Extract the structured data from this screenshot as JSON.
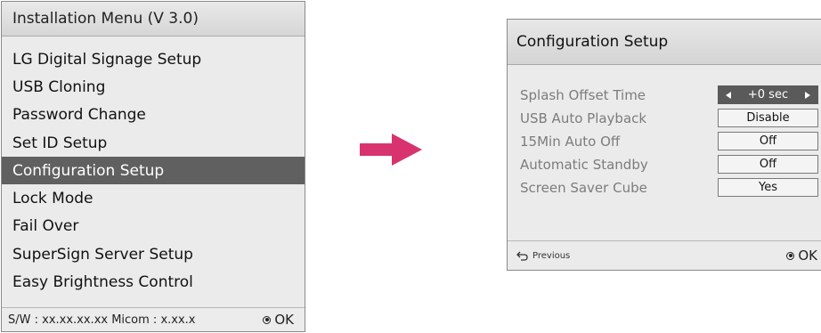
{
  "installation_menu": {
    "title": "Installation Menu (V 3.0)",
    "items": [
      {
        "label": "LG Digital Signage Setup",
        "selected": false
      },
      {
        "label": "USB Cloning",
        "selected": false
      },
      {
        "label": "Password Change",
        "selected": false
      },
      {
        "label": "Set ID Setup",
        "selected": false
      },
      {
        "label": "Configuration Setup",
        "selected": true
      },
      {
        "label": "Lock Mode",
        "selected": false
      },
      {
        "label": "Fail Over",
        "selected": false
      },
      {
        "label": "SuperSign Server Setup",
        "selected": false
      },
      {
        "label": "Easy Brightness Control",
        "selected": false
      }
    ],
    "footer": {
      "version_info": "S/W : xx.xx.xx.xx Micom : x.xx.x",
      "ok_label": "OK",
      "ok_icon": "ok-button-icon"
    }
  },
  "arrow": {
    "color": "#d8336f",
    "icon": "right-arrow-icon"
  },
  "configuration_setup": {
    "title": "Configuration Setup",
    "rows": [
      {
        "label": "Splash Offset Time",
        "value": "+0 sec",
        "active": true
      },
      {
        "label": "USB Auto Playback",
        "value": "Disable",
        "active": false
      },
      {
        "label": "15Min Auto Off",
        "value": "Off",
        "active": false
      },
      {
        "label": "Automatic Standby",
        "value": "Off",
        "active": false
      },
      {
        "label": "Screen Saver Cube",
        "value": "Yes",
        "active": false
      }
    ],
    "footer": {
      "previous_label": "Previous",
      "previous_icon": "return-arrow-icon",
      "ok_label": "OK",
      "ok_icon": "ok-button-icon"
    }
  },
  "colors": {
    "selected_background": "#606060",
    "panel_background": "#ebebeb",
    "label_gray": "#7c7c7c"
  }
}
